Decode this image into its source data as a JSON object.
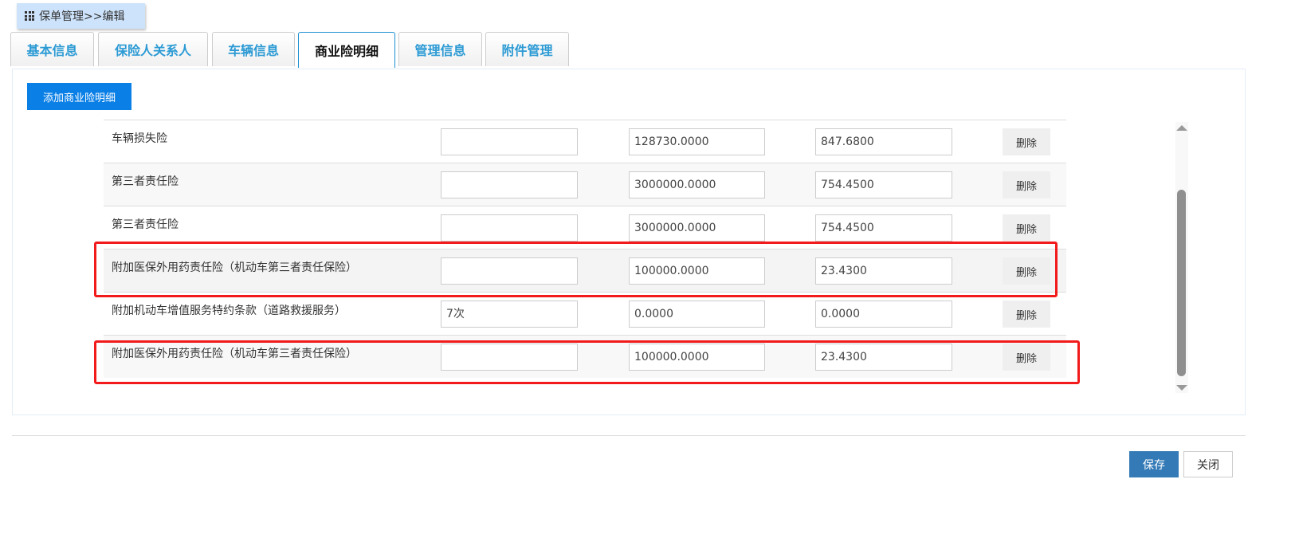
{
  "breadcrumb": "保单管理>>编辑",
  "tabs": [
    "基本信息",
    "保险人关系人",
    "车辆信息",
    "商业险明细",
    "管理信息",
    "附件管理"
  ],
  "active_tab": "商业险明细",
  "add_button": "添加商业险明细",
  "rows": [
    {
      "name": "车辆损失险",
      "c1": "",
      "c2": "128730.0000",
      "c3": "847.6800",
      "delete": "删除"
    },
    {
      "name": "第三者责任险",
      "c1": "",
      "c2": "3000000.0000",
      "c3": "754.4500",
      "delete": "删除"
    },
    {
      "name": "第三者责任险",
      "c1": "",
      "c2": "3000000.0000",
      "c3": "754.4500",
      "delete": "删除"
    },
    {
      "name": "附加医保外用药责任险（机动车第三者责任保险）",
      "c1": "",
      "c2": "100000.0000",
      "c3": "23.4300",
      "delete": "删除"
    },
    {
      "name": "附加机动车增值服务特约条款（道路救援服务）",
      "c1": "7次",
      "c2": "0.0000",
      "c3": "0.0000",
      "delete": "删除"
    },
    {
      "name": "附加医保外用药责任险（机动车第三者责任保险）",
      "c1": "",
      "c2": "100000.0000",
      "c3": "23.4300",
      "delete": "删除"
    }
  ],
  "footer": {
    "save": "保存",
    "close": "关闭"
  },
  "colors": {
    "accent": "#0a7fe6",
    "highlight": "#f21a1a",
    "save": "#337ab7"
  }
}
